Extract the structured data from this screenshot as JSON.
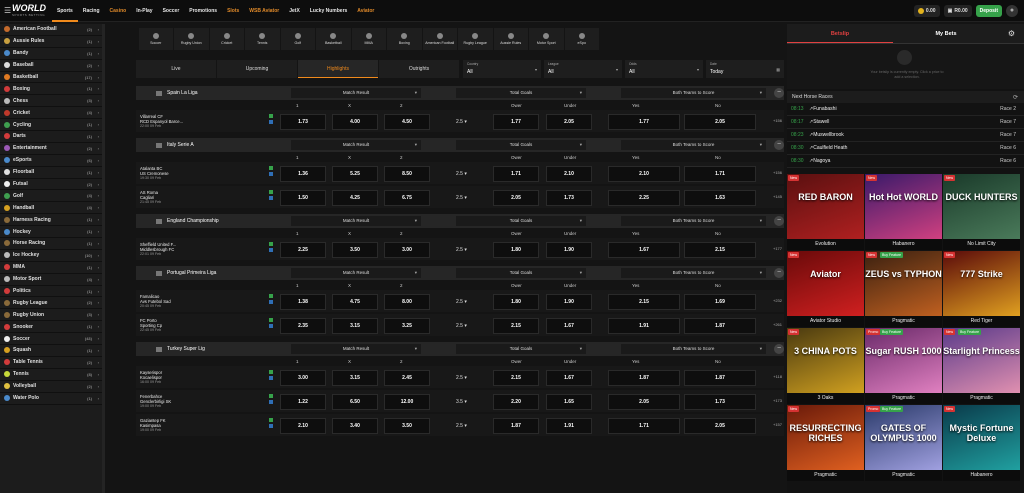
{
  "header": {
    "logo_main": "WORLD",
    "logo_sub": "SPORTS BETTING",
    "nav": [
      {
        "label": "Sports",
        "active": true,
        "orange": false
      },
      {
        "label": "Racing",
        "active": false,
        "orange": false
      },
      {
        "label": "Casino",
        "active": false,
        "orange": true
      },
      {
        "label": "In-Play",
        "active": false,
        "orange": false
      },
      {
        "label": "Soccer",
        "active": false,
        "orange": false
      },
      {
        "label": "Promotions",
        "active": false,
        "orange": false
      },
      {
        "label": "Slots",
        "active": false,
        "orange": true
      },
      {
        "label": "WSB Aviator",
        "active": false,
        "orange": true
      },
      {
        "label": "JetX",
        "active": false,
        "orange": false
      },
      {
        "label": "Lucky Numbers",
        "active": false,
        "orange": false
      },
      {
        "label": "Aviator",
        "active": false,
        "orange": true
      }
    ],
    "bonus_balance": "0.00",
    "cash_balance": "R0.00",
    "deposit_label": "Deposit"
  },
  "sidebar": {
    "items": [
      {
        "label": "American Football",
        "count": "(2)",
        "color": "#c46a2c"
      },
      {
        "label": "Aussie Rules",
        "count": "(1)",
        "color": "#c9a040"
      },
      {
        "label": "Bandy",
        "count": "(1)",
        "color": "#4a8acb"
      },
      {
        "label": "Baseball",
        "count": "(2)",
        "color": "#dddddd"
      },
      {
        "label": "Basketball",
        "count": "(17)",
        "color": "#e07a22"
      },
      {
        "label": "Boxing",
        "count": "(1)",
        "color": "#d23b3b"
      },
      {
        "label": "Chess",
        "count": "(3)",
        "color": "#bbbbbb"
      },
      {
        "label": "Cricket",
        "count": "(4)",
        "color": "#c0392b"
      },
      {
        "label": "Cycling",
        "count": "(1)",
        "color": "#3f9e4f"
      },
      {
        "label": "Darts",
        "count": "(1)",
        "color": "#d23b3b"
      },
      {
        "label": "Entertainment",
        "count": "(2)",
        "color": "#9b59b6"
      },
      {
        "label": "eSports",
        "count": "(6)",
        "color": "#4a8acb"
      },
      {
        "label": "Floorball",
        "count": "(1)",
        "color": "#e0e0e0"
      },
      {
        "label": "Futsal",
        "count": "(2)",
        "color": "#eeeeee"
      },
      {
        "label": "Golf",
        "count": "(4)",
        "color": "#3f9e4f"
      },
      {
        "label": "Handball",
        "count": "(4)",
        "color": "#d6a020"
      },
      {
        "label": "Harness Racing",
        "count": "(1)",
        "color": "#8a6a3a"
      },
      {
        "label": "Hockey",
        "count": "(1)",
        "color": "#4a8acb"
      },
      {
        "label": "Horse Racing",
        "count": "(1)",
        "color": "#8a6a3a"
      },
      {
        "label": "Ice Hockey",
        "count": "(10)",
        "color": "#bbbbbb"
      },
      {
        "label": "MMA",
        "count": "(1)",
        "color": "#d23b3b"
      },
      {
        "label": "Motor Sport",
        "count": "(4)",
        "color": "#bbbbbb"
      },
      {
        "label": "Politics",
        "count": "(1)",
        "color": "#d23b3b"
      },
      {
        "label": "Rugby League",
        "count": "(2)",
        "color": "#8a6a3a"
      },
      {
        "label": "Rugby Union",
        "count": "(3)",
        "color": "#8a6a3a"
      },
      {
        "label": "Snooker",
        "count": "(1)",
        "color": "#d23b3b"
      },
      {
        "label": "Soccer",
        "count": "(43)",
        "color": "#eeeeee"
      },
      {
        "label": "Squash",
        "count": "(1)",
        "color": "#d6a020"
      },
      {
        "label": "Table Tennis",
        "count": "(2)",
        "color": "#d23b3b"
      },
      {
        "label": "Tennis",
        "count": "(8)",
        "color": "#c7d93a"
      },
      {
        "label": "Volleyball",
        "count": "(2)",
        "color": "#e0c040"
      },
      {
        "label": "Water Polo",
        "count": "(1)",
        "color": "#4a8acb"
      }
    ]
  },
  "sport_tabs": [
    "Soccer",
    "Rugby Union",
    "Cricket",
    "Tennis",
    "Golf",
    "Basketball",
    "MMA",
    "Boxing",
    "American Football",
    "Rugby League",
    "Aussie Rules",
    "Motor Sport",
    "eSpo"
  ],
  "filter_tabs": [
    {
      "label": "Live",
      "active": false
    },
    {
      "label": "Upcoming",
      "active": false
    },
    {
      "label": "Highlights",
      "active": true
    },
    {
      "label": "Outrights",
      "active": false
    }
  ],
  "filters": [
    {
      "label": "Country",
      "value": "All"
    },
    {
      "label": "League",
      "value": "All"
    },
    {
      "label": "Odds",
      "value": "All"
    },
    {
      "label": "Date",
      "value": "Today"
    }
  ],
  "markets": {
    "m1": "Match Result",
    "m2": "Total Goals",
    "m3": "Both Teams to Score"
  },
  "cols": {
    "c1": "1",
    "c2": "X",
    "c3": "2",
    "c4": "Ower",
    "c5": "Under",
    "c6": "Yes",
    "c7": "No"
  },
  "leagues": [
    {
      "name": "Spain La Liga",
      "matches": [
        {
          "home": "Villarreal CF",
          "away": "RCD Espanyol Barce...",
          "time": "22:00 09 Feb",
          "o1": "1.73",
          "ox": "4.00",
          "o2": "4.50",
          "gl": "2.5",
          "ov": "1.77",
          "un": "2.05",
          "yes": "1.77",
          "no": "2.05",
          "more": "+156"
        }
      ]
    },
    {
      "name": "Italy Serie A",
      "matches": [
        {
          "home": "Atalanta BC",
          "away": "US Cremonese",
          "time": "19:30 09 Feb",
          "o1": "1.36",
          "ox": "5.25",
          "o2": "8.50",
          "gl": "2.5",
          "ov": "1.71",
          "un": "2.10",
          "yes": "2.10",
          "no": "1.71",
          "more": "+156"
        },
        {
          "home": "AS Roma",
          "away": "Cagliari",
          "time": "21:45 09 Feb",
          "o1": "1.50",
          "ox": "4.25",
          "o2": "6.75",
          "gl": "2.5",
          "ov": "2.05",
          "un": "1.73",
          "yes": "2.25",
          "no": "1.63",
          "more": "+145"
        }
      ]
    },
    {
      "name": "England Championship",
      "matches": [
        {
          "home": "Sheffield United F...",
          "away": "Middlesbrough FC",
          "time": "22:01 09 Feb",
          "o1": "2.25",
          "ox": "3.50",
          "o2": "3.00",
          "gl": "2.5",
          "ov": "1.80",
          "un": "1.90",
          "yes": "1.67",
          "no": "2.15",
          "more": "+177"
        }
      ]
    },
    {
      "name": "Portugal Primeira Liga",
      "matches": [
        {
          "home": "Famalicao",
          "away": "Avs Futebol Sad",
          "time": "20:45 09 Feb",
          "o1": "1.38",
          "ox": "4.75",
          "o2": "8.00",
          "gl": "2.5",
          "ov": "1.80",
          "un": "1.90",
          "yes": "2.15",
          "no": "1.69",
          "more": "+232"
        },
        {
          "home": "FC Porto",
          "away": "Sporting Cp",
          "time": "22:45 09 Feb",
          "o1": "2.35",
          "ox": "3.15",
          "o2": "3.25",
          "gl": "2.5",
          "ov": "2.15",
          "un": "1.67",
          "yes": "1.91",
          "no": "1.87",
          "more": "+261"
        }
      ]
    },
    {
      "name": "Turkey Super Lig",
      "matches": [
        {
          "home": "Kayserispor",
          "away": "Kocaelispor",
          "time": "16:00 09 Feb",
          "o1": "3.00",
          "ox": "3.15",
          "o2": "2.45",
          "gl": "2.5",
          "ov": "2.15",
          "un": "1.67",
          "yes": "1.87",
          "no": "1.87",
          "more": "+118"
        },
        {
          "home": "Fenerbahce",
          "away": "Genclerbirligi SK",
          "time": "19:00 09 Feb",
          "o1": "1.22",
          "ox": "6.50",
          "o2": "12.00",
          "gl": "3.5",
          "ov": "2.20",
          "un": "1.65",
          "yes": "2.05",
          "no": "1.73",
          "more": "+173"
        },
        {
          "home": "Gaziantep FK",
          "away": "Kasimpasa",
          "time": "19:00 09 Feb",
          "o1": "2.10",
          "ox": "3.40",
          "o2": "3.50",
          "gl": "2.5",
          "ov": "1.87",
          "un": "1.91",
          "yes": "1.71",
          "no": "2.05",
          "more": "+157"
        }
      ]
    }
  ],
  "betslip": {
    "tab1": "Betslip",
    "tab2": "My Bets",
    "empty_text": "Your betslip is currently empty. Click a price to add a selection.",
    "races_title": "Next Horse Races",
    "races": [
      {
        "time": "08:13",
        "name": "Funabashi",
        "race": "Race 2"
      },
      {
        "time": "08:17",
        "name": "Stawell",
        "race": "Race 7"
      },
      {
        "time": "08:23",
        "name": "Muswellbrook",
        "race": "Race 7"
      },
      {
        "time": "08:30",
        "name": "Caulfield Heath",
        "race": "Race 6"
      },
      {
        "time": "08:30",
        "name": "Nagoya",
        "race": "Race 6"
      }
    ]
  },
  "games": [
    {
      "title": "RED BARON",
      "provider": "Evolution",
      "badge": "New",
      "feature": "",
      "c1": "#5a1010",
      "c2": "#b02020"
    },
    {
      "title": "Hot Hot WORLD",
      "provider": "Habanero",
      "badge": "New",
      "feature": "",
      "c1": "#3a1a6a",
      "c2": "#d04080"
    },
    {
      "title": "DUCK HUNTERS",
      "provider": "No Limit City",
      "badge": "New",
      "feature": "",
      "c1": "#1a3a2a",
      "c2": "#4a7a5a"
    },
    {
      "title": "Aviator",
      "provider": "Aviator Studio",
      "badge": "New",
      "feature": "",
      "c1": "#6a0a0a",
      "c2": "#d02020"
    },
    {
      "title": "ZEUS vs TYPHON",
      "provider": "Pragmatic",
      "badge": "New",
      "feature": "Buy Feature",
      "c1": "#3a2010",
      "c2": "#c06020"
    },
    {
      "title": "777 Strike",
      "provider": "Red Tiger",
      "badge": "New",
      "feature": "",
      "c1": "#5a0a0a",
      "c2": "#e0a020"
    },
    {
      "title": "3 CHINA POTS",
      "provider": "3 Oaks",
      "badge": "New",
      "feature": "",
      "c1": "#4a3a10",
      "c2": "#d0a020"
    },
    {
      "title": "Sugar RUSH 1000",
      "provider": "Pragmatic",
      "badge": "Promo",
      "feature": "Buy Feature",
      "c1": "#6a2a6a",
      "c2": "#e080c0"
    },
    {
      "title": "Starlight Princess",
      "provider": "Pragmatic",
      "badge": "New",
      "feature": "Buy Feature",
      "c1": "#5a3a8a",
      "c2": "#e090b0"
    },
    {
      "title": "RESURRECTING RICHES",
      "provider": "Pragmatic",
      "badge": "New",
      "feature": "",
      "c1": "#6a1a0a",
      "c2": "#e06020"
    },
    {
      "title": "GATES OF OLYMPUS 1000",
      "provider": "Pragmatic",
      "badge": "Promo",
      "feature": "Buy Feature",
      "c1": "#2a3a6a",
      "c2": "#a0a0e0"
    },
    {
      "title": "Mystic Fortune Deluxe",
      "provider": "Habanero",
      "badge": "New",
      "feature": "",
      "c1": "#0a3a4a",
      "c2": "#20a0a0"
    }
  ]
}
